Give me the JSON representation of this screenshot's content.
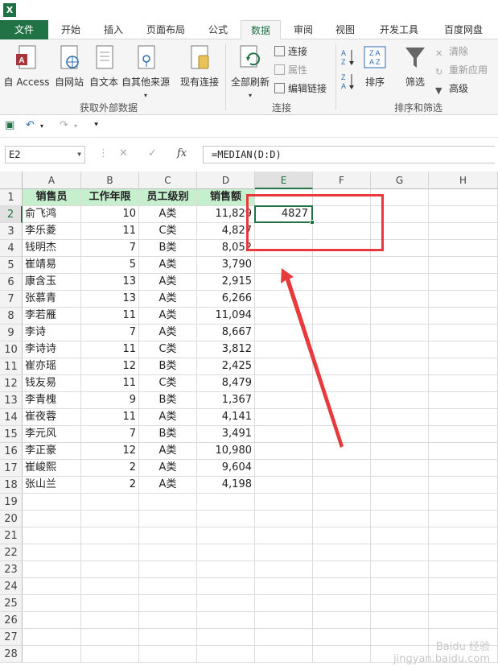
{
  "app": {
    "logo_text": "X"
  },
  "ribbon_tabs": [
    "文件",
    "开始",
    "插入",
    "页面布局",
    "公式",
    "数据",
    "审阅",
    "视图",
    "开发工具",
    "百度网盘"
  ],
  "ribbon": {
    "groups": {
      "external": "获取外部数据",
      "connections": "连接",
      "sort_filter": "排序和筛选"
    },
    "buttons": {
      "from_access": "自 Access",
      "from_web": "自网站",
      "from_text": "自文本",
      "from_other": "自其他来源",
      "existing_conn": "现有连接",
      "refresh_all": "全部刷新",
      "connections": "连接",
      "properties": "属性",
      "edit_links": "编辑链接",
      "sort": "排序",
      "filter": "筛选",
      "clear": "清除",
      "reapply": "重新应用",
      "advanced": "高级"
    }
  },
  "formula_bar": {
    "name_box": "E2",
    "formula": "=MEDIAN(D:D)",
    "fx_label": "fx"
  },
  "columns": [
    "A",
    "B",
    "C",
    "D",
    "E",
    "F",
    "G",
    "H"
  ],
  "rows": [
    1,
    2,
    3,
    4,
    5,
    6,
    7,
    8,
    9,
    10,
    11,
    12,
    13,
    14,
    15,
    16,
    17,
    18,
    19,
    20,
    21,
    22,
    23,
    24,
    25,
    26,
    27,
    28
  ],
  "table_headers": [
    "销售员",
    "工作年限",
    "员工级别",
    "销售额"
  ],
  "table_rows": [
    [
      "俞飞鸿",
      "10",
      "A类",
      "11,829"
    ],
    [
      "李乐菱",
      "11",
      "C类",
      "4,827"
    ],
    [
      "钱明杰",
      "7",
      "B类",
      "8,052"
    ],
    [
      "崔靖易",
      "5",
      "A类",
      "3,790"
    ],
    [
      "康含玉",
      "13",
      "A类",
      "2,915"
    ],
    [
      "张慕青",
      "13",
      "A类",
      "6,266"
    ],
    [
      "李若雁",
      "11",
      "A类",
      "11,094"
    ],
    [
      "李诗",
      "7",
      "A类",
      "8,667"
    ],
    [
      "李诗诗",
      "11",
      "C类",
      "3,812"
    ],
    [
      "崔亦瑶",
      "12",
      "B类",
      "2,425"
    ],
    [
      "钱友易",
      "11",
      "C类",
      "8,479"
    ],
    [
      "李青槐",
      "9",
      "B类",
      "1,367"
    ],
    [
      "崔夜蓉",
      "11",
      "A类",
      "4,141"
    ],
    [
      "李元风",
      "7",
      "B类",
      "3,491"
    ],
    [
      "李正豪",
      "12",
      "A类",
      "10,980"
    ],
    [
      "崔峻熙",
      "2",
      "A类",
      "9,604"
    ],
    [
      "张山兰",
      "2",
      "A类",
      "4,198"
    ]
  ],
  "active_cell": {
    "ref": "E2",
    "value": "4827"
  },
  "watermark": {
    "line1": "Baidu 经验",
    "line2": "jingyan.baidu.com"
  },
  "colors": {
    "excel_green": "#217346",
    "header_fill": "#c6efce",
    "annotation_red": "#e8393d"
  }
}
